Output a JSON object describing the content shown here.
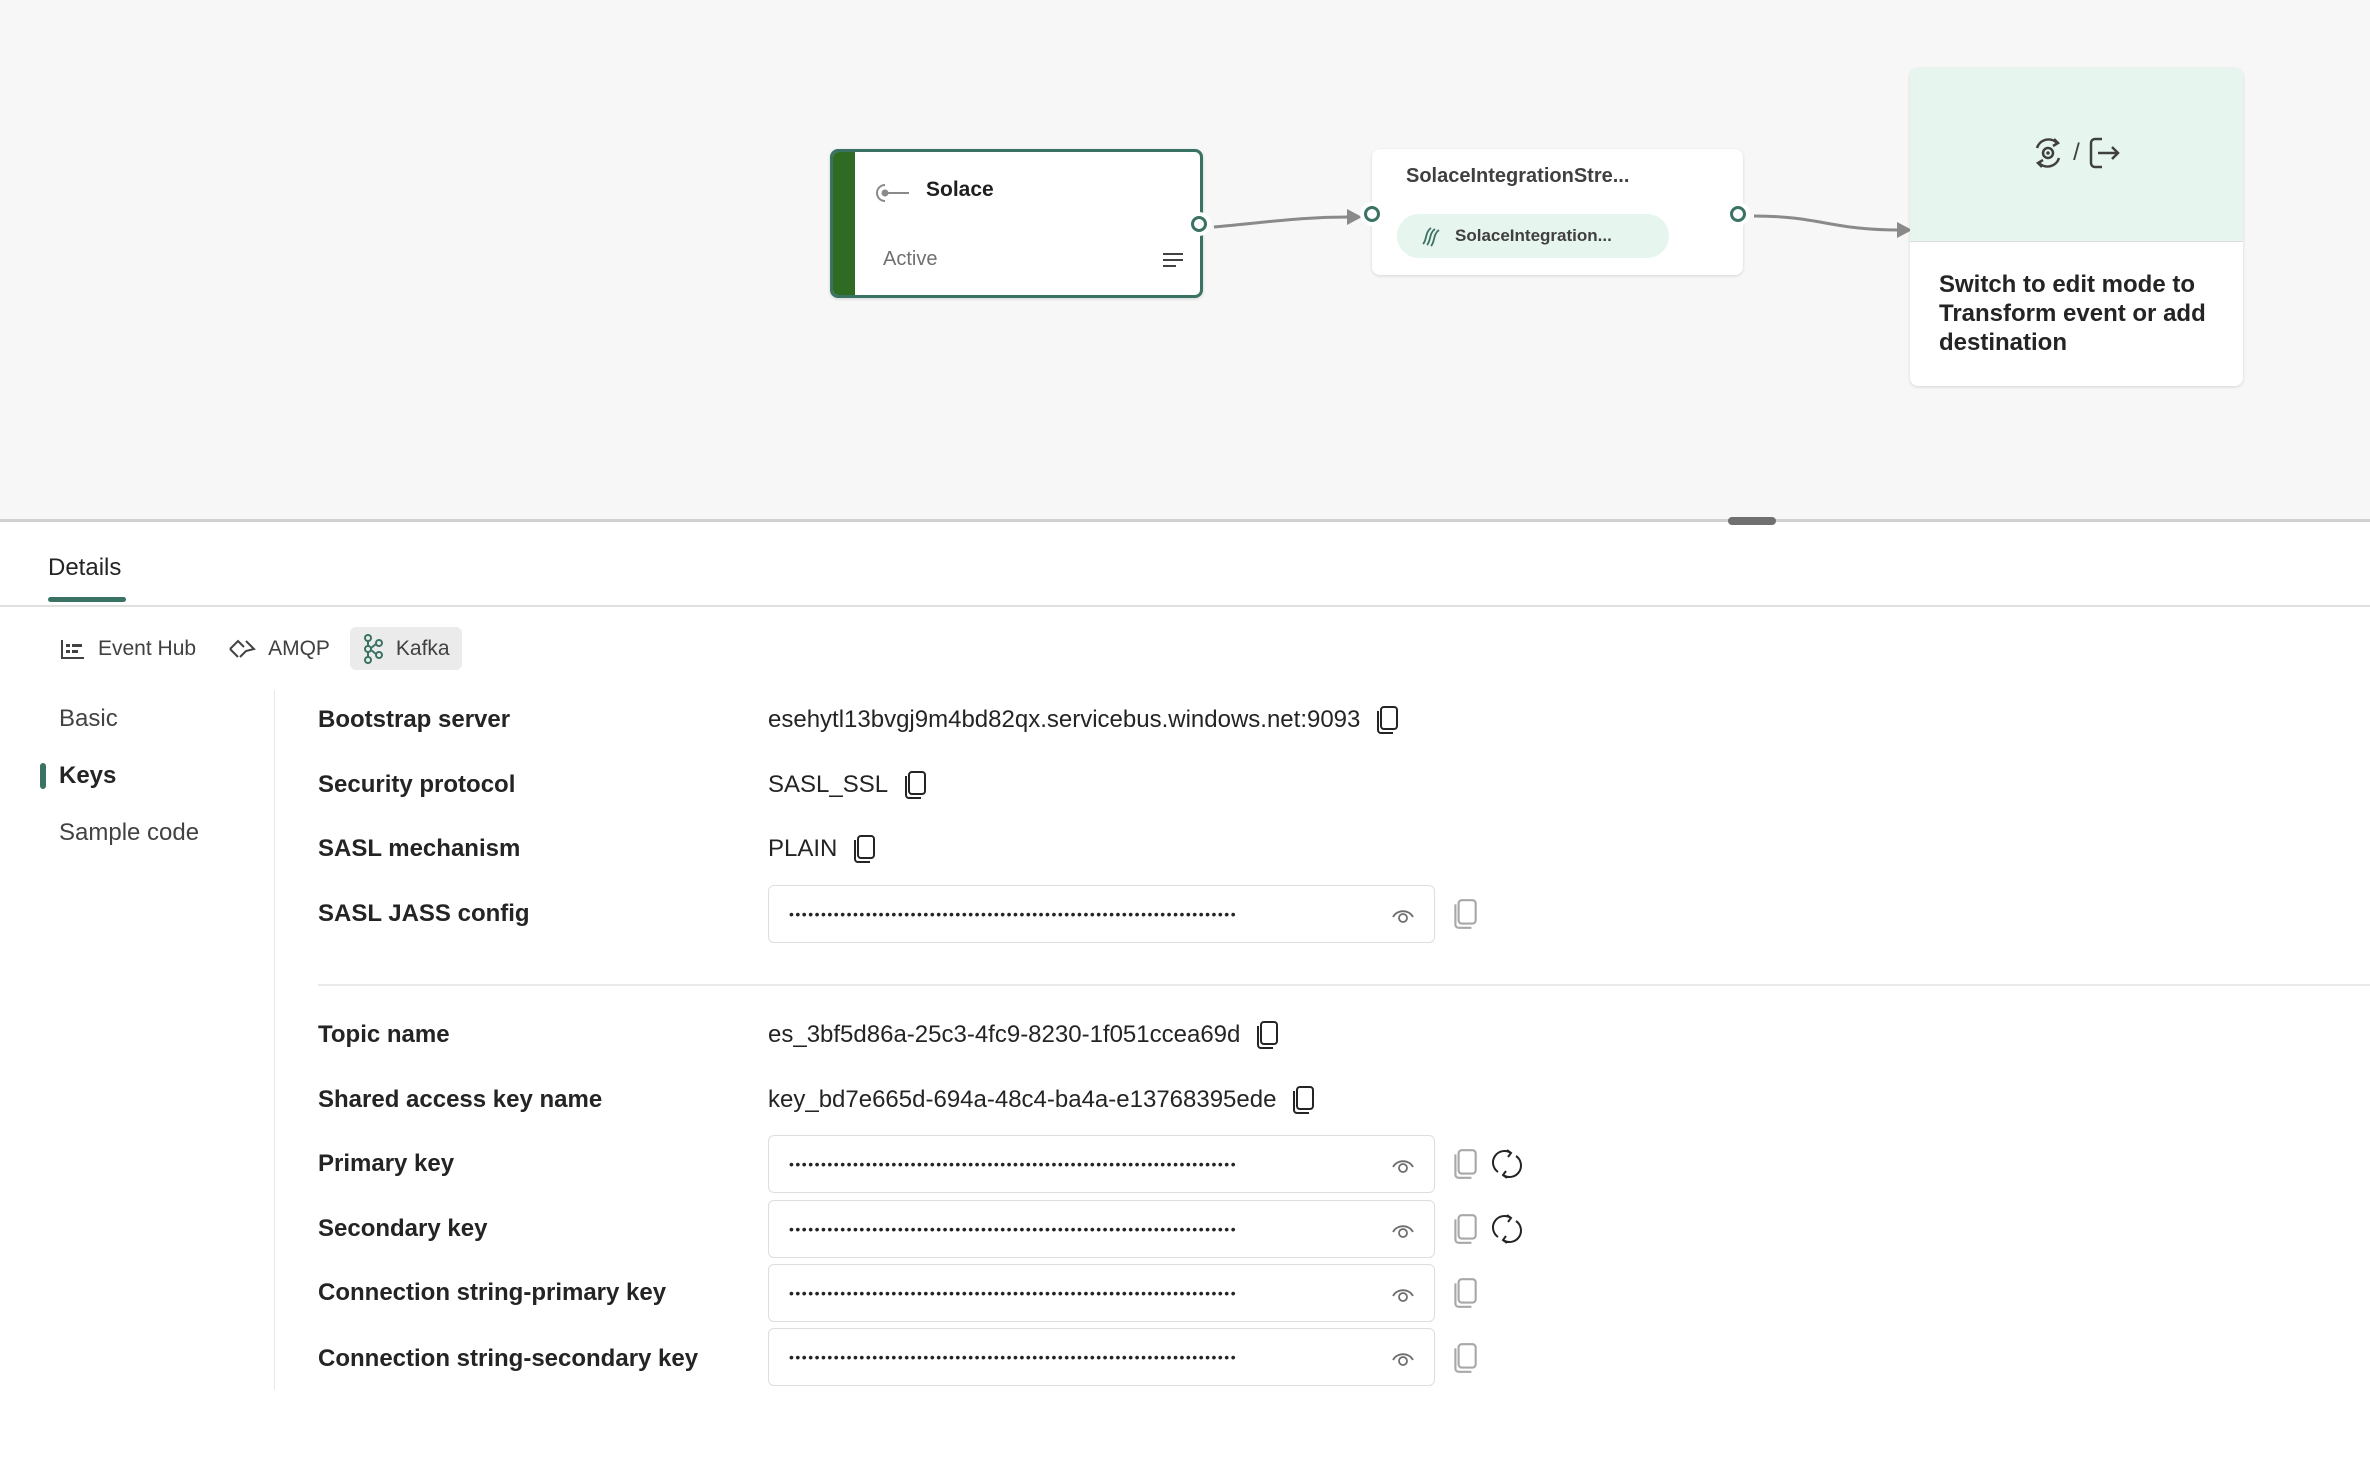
{
  "canvas": {
    "source_node": {
      "title": "Solace",
      "status": "Active",
      "icon": "source-plug-icon",
      "menu_icon": "lines-icon"
    },
    "stream_node": {
      "title": "SolaceIntegrationStre...",
      "chip_label": "SolaceIntegration...",
      "chip_icon": "stream-icon"
    },
    "destination_node": {
      "hint": "Switch to edit mode to Transform event or add destination",
      "separator": "/",
      "icons": [
        "transform-gear-icon",
        "export-arrow-icon"
      ]
    }
  },
  "details": {
    "tab_label": "Details",
    "protocols": [
      {
        "label": "Event Hub",
        "icon": "event-hub-icon",
        "active": false
      },
      {
        "label": "AMQP",
        "icon": "amqp-icon",
        "active": false
      },
      {
        "label": "Kafka",
        "icon": "kafka-icon",
        "active": true
      }
    ],
    "nav": [
      {
        "label": "Basic",
        "active": false
      },
      {
        "label": "Keys",
        "active": true
      },
      {
        "label": "Sample code",
        "active": false
      }
    ],
    "fields": {
      "bootstrap_server": {
        "label": "Bootstrap server",
        "value": "esehytl13bvgj9m4bd82qx.servicebus.windows.net:9093"
      },
      "security_protocol": {
        "label": "Security protocol",
        "value": "SASL_SSL"
      },
      "sasl_mechanism": {
        "label": "SASL mechanism",
        "value": "PLAIN"
      },
      "sasl_jass_config": {
        "label": "SASL JASS config",
        "masked": "••••••••••••••••••••••••••••••••••••••••••••••••••••••••••••••••••••••"
      },
      "topic_name": {
        "label": "Topic name",
        "value": "es_3bf5d86a-25c3-4fc9-8230-1f051ccea69d"
      },
      "shared_access_key_name": {
        "label": "Shared access key name",
        "value": "key_bd7e665d-694a-48c4-ba4a-e13768395ede"
      },
      "primary_key": {
        "label": "Primary key",
        "masked": "••••••••••••••••••••••••••••••••••••••••••••••••••••••••••••••••••••••"
      },
      "secondary_key": {
        "label": "Secondary key",
        "masked": "••••••••••••••••••••••••••••••••••••••••••••••••••••••••••••••••••••••"
      },
      "conn_primary": {
        "label": "Connection string-primary key",
        "masked": "••••••••••••••••••••••••••••••••••••••••••••••••••••••••••••••••••••••"
      },
      "conn_secondary": {
        "label": "Connection string-secondary key",
        "masked": "••••••••••••••••••••••••••••••••••••••••••••••••••••••••••••••••••••••"
      }
    }
  },
  "colors": {
    "accent": "#3a7364",
    "source_stripe": "#306b24",
    "chip_bg": "#e6f5ee",
    "canvas_bg": "#f7f7f7"
  }
}
